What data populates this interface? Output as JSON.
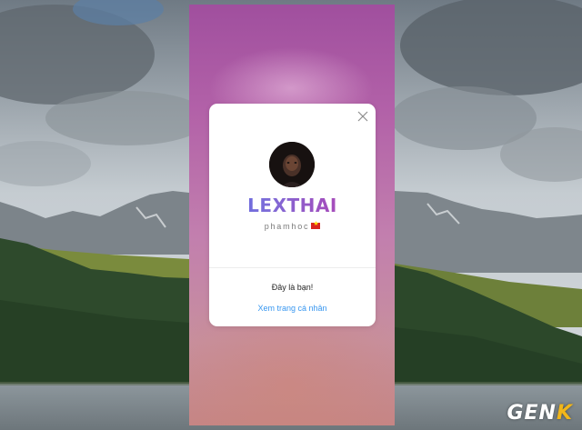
{
  "profile_card": {
    "display_name": "LEXTHAI",
    "username": "phamhoc",
    "message": "Đây là bạn!",
    "view_profile_link": "Xem trang cá nhân",
    "close_icon": "close-icon",
    "flag_icon": "vietnam-flag-icon"
  },
  "colors": {
    "link": "#3897f0",
    "name_gradient_start": "#5a6ee6",
    "name_gradient_end": "#c04ab0",
    "watermark_accent": "#f2b61a"
  },
  "watermark": {
    "text_main": "GEN",
    "text_accent": "K"
  }
}
